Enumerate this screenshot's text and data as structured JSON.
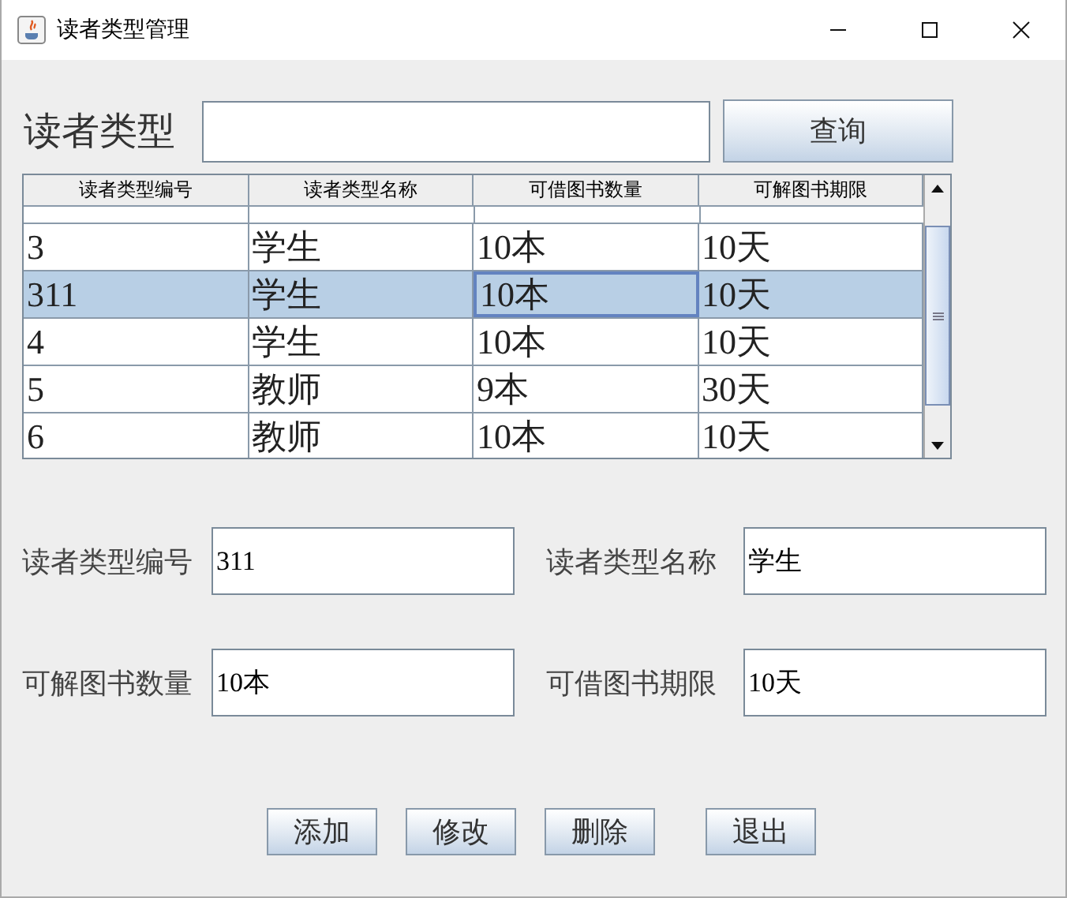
{
  "window": {
    "title": "读者类型管理"
  },
  "search": {
    "label": "读者类型",
    "button": "查询"
  },
  "table": {
    "columns": [
      "读者类型编号",
      "读者类型名称",
      "可借图书数量",
      "可解图书期限"
    ],
    "rows": [
      {
        "selected": false,
        "cells": [
          {
            "text": "3",
            "focused": false
          },
          {
            "text": "学生",
            "focused": false
          },
          {
            "text": "10本",
            "focused": false
          },
          {
            "text": "10天",
            "focused": false
          }
        ]
      },
      {
        "selected": true,
        "cells": [
          {
            "text": "311",
            "focused": false
          },
          {
            "text": "学生",
            "focused": false
          },
          {
            "text": "10本",
            "focused": true
          },
          {
            "text": "10天",
            "focused": false
          }
        ]
      },
      {
        "selected": false,
        "cells": [
          {
            "text": "4",
            "focused": false
          },
          {
            "text": "学生",
            "focused": false
          },
          {
            "text": "10本",
            "focused": false
          },
          {
            "text": "10天",
            "focused": false
          }
        ]
      },
      {
        "selected": false,
        "cells": [
          {
            "text": "5",
            "focused": false
          },
          {
            "text": "教师",
            "focused": false
          },
          {
            "text": "9本",
            "focused": false
          },
          {
            "text": "30天",
            "focused": false
          }
        ]
      },
      {
        "selected": false,
        "cells": [
          {
            "text": "6",
            "focused": false
          },
          {
            "text": "教师",
            "focused": false
          },
          {
            "text": "10本",
            "focused": false
          },
          {
            "text": "10天",
            "focused": false
          }
        ]
      }
    ]
  },
  "form": [
    {
      "label": "读者类型编号",
      "value": "311"
    },
    {
      "label": "读者类型名称",
      "value": "学生"
    },
    {
      "label": "可解图书数量",
      "value": "10本"
    },
    {
      "label": "可借图书期限",
      "value": "10天"
    }
  ],
  "buttons": [
    "添加",
    "修改",
    "删除",
    "退出"
  ]
}
